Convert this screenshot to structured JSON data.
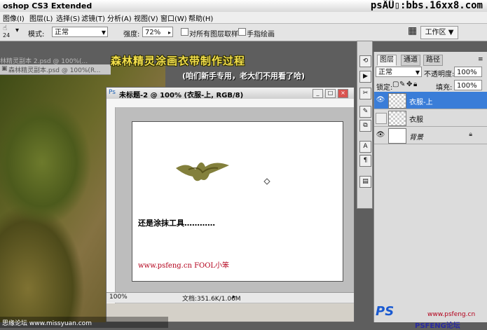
{
  "app_title": "oshop CS3 Extended",
  "site_banner": "psÂÛ▯:bbs.16xx8.com",
  "menu": [
    "图像(I)",
    "图层(L)",
    "选择(S)",
    "滤镜(T)",
    "分析(A)",
    "视图(V)",
    "窗口(W)",
    "帮助(H)"
  ],
  "options": {
    "brush_size": "24",
    "mode_label": "模式:",
    "mode_value": "正常",
    "strength_label": "强度:",
    "strength_value": "72%",
    "sample_all_label": "对所有图层取样",
    "finger_paint_label": "手指绘画",
    "workspace_label": "工作区 ▼"
  },
  "overlay": {
    "title": "森林精灵涂画衣带制作过程",
    "subtitle": "(咱们新手专用，老大们不用看了哈)"
  },
  "background_docs": {
    "tab_1": "林精灵副本 2.psd @ 100%(...",
    "tab_2": "森林精灵副本.psd @ 100%(R..."
  },
  "document": {
    "title": "未标题-2 @ 100% (衣服-上, RGB/8)",
    "hint": "还是涂抹工具…………",
    "signature": "www.psfeng.cn   FOOL小笨",
    "zoom": "100%",
    "doc_size": "文档:351.6K/1.06M"
  },
  "layers_panel": {
    "tabs": [
      "图层",
      "通道",
      "路径"
    ],
    "blend_mode": "正常",
    "opacity_label": "不透明度:",
    "opacity_value": "100%",
    "lock_label": "锁定:",
    "fill_label": "填充:",
    "fill_value": "100%",
    "layers": [
      {
        "name": "衣服-上",
        "visible": true,
        "selected": true
      },
      {
        "name": "衣服",
        "visible": false,
        "selected": false
      },
      {
        "name": "背景",
        "visible": true,
        "selected": false
      }
    ]
  },
  "footer": {
    "left_text": "思缘论坛  www.missyuan.com",
    "logo_url": "www.psfeng.cn",
    "logo_text": "PSFENG论坛"
  }
}
